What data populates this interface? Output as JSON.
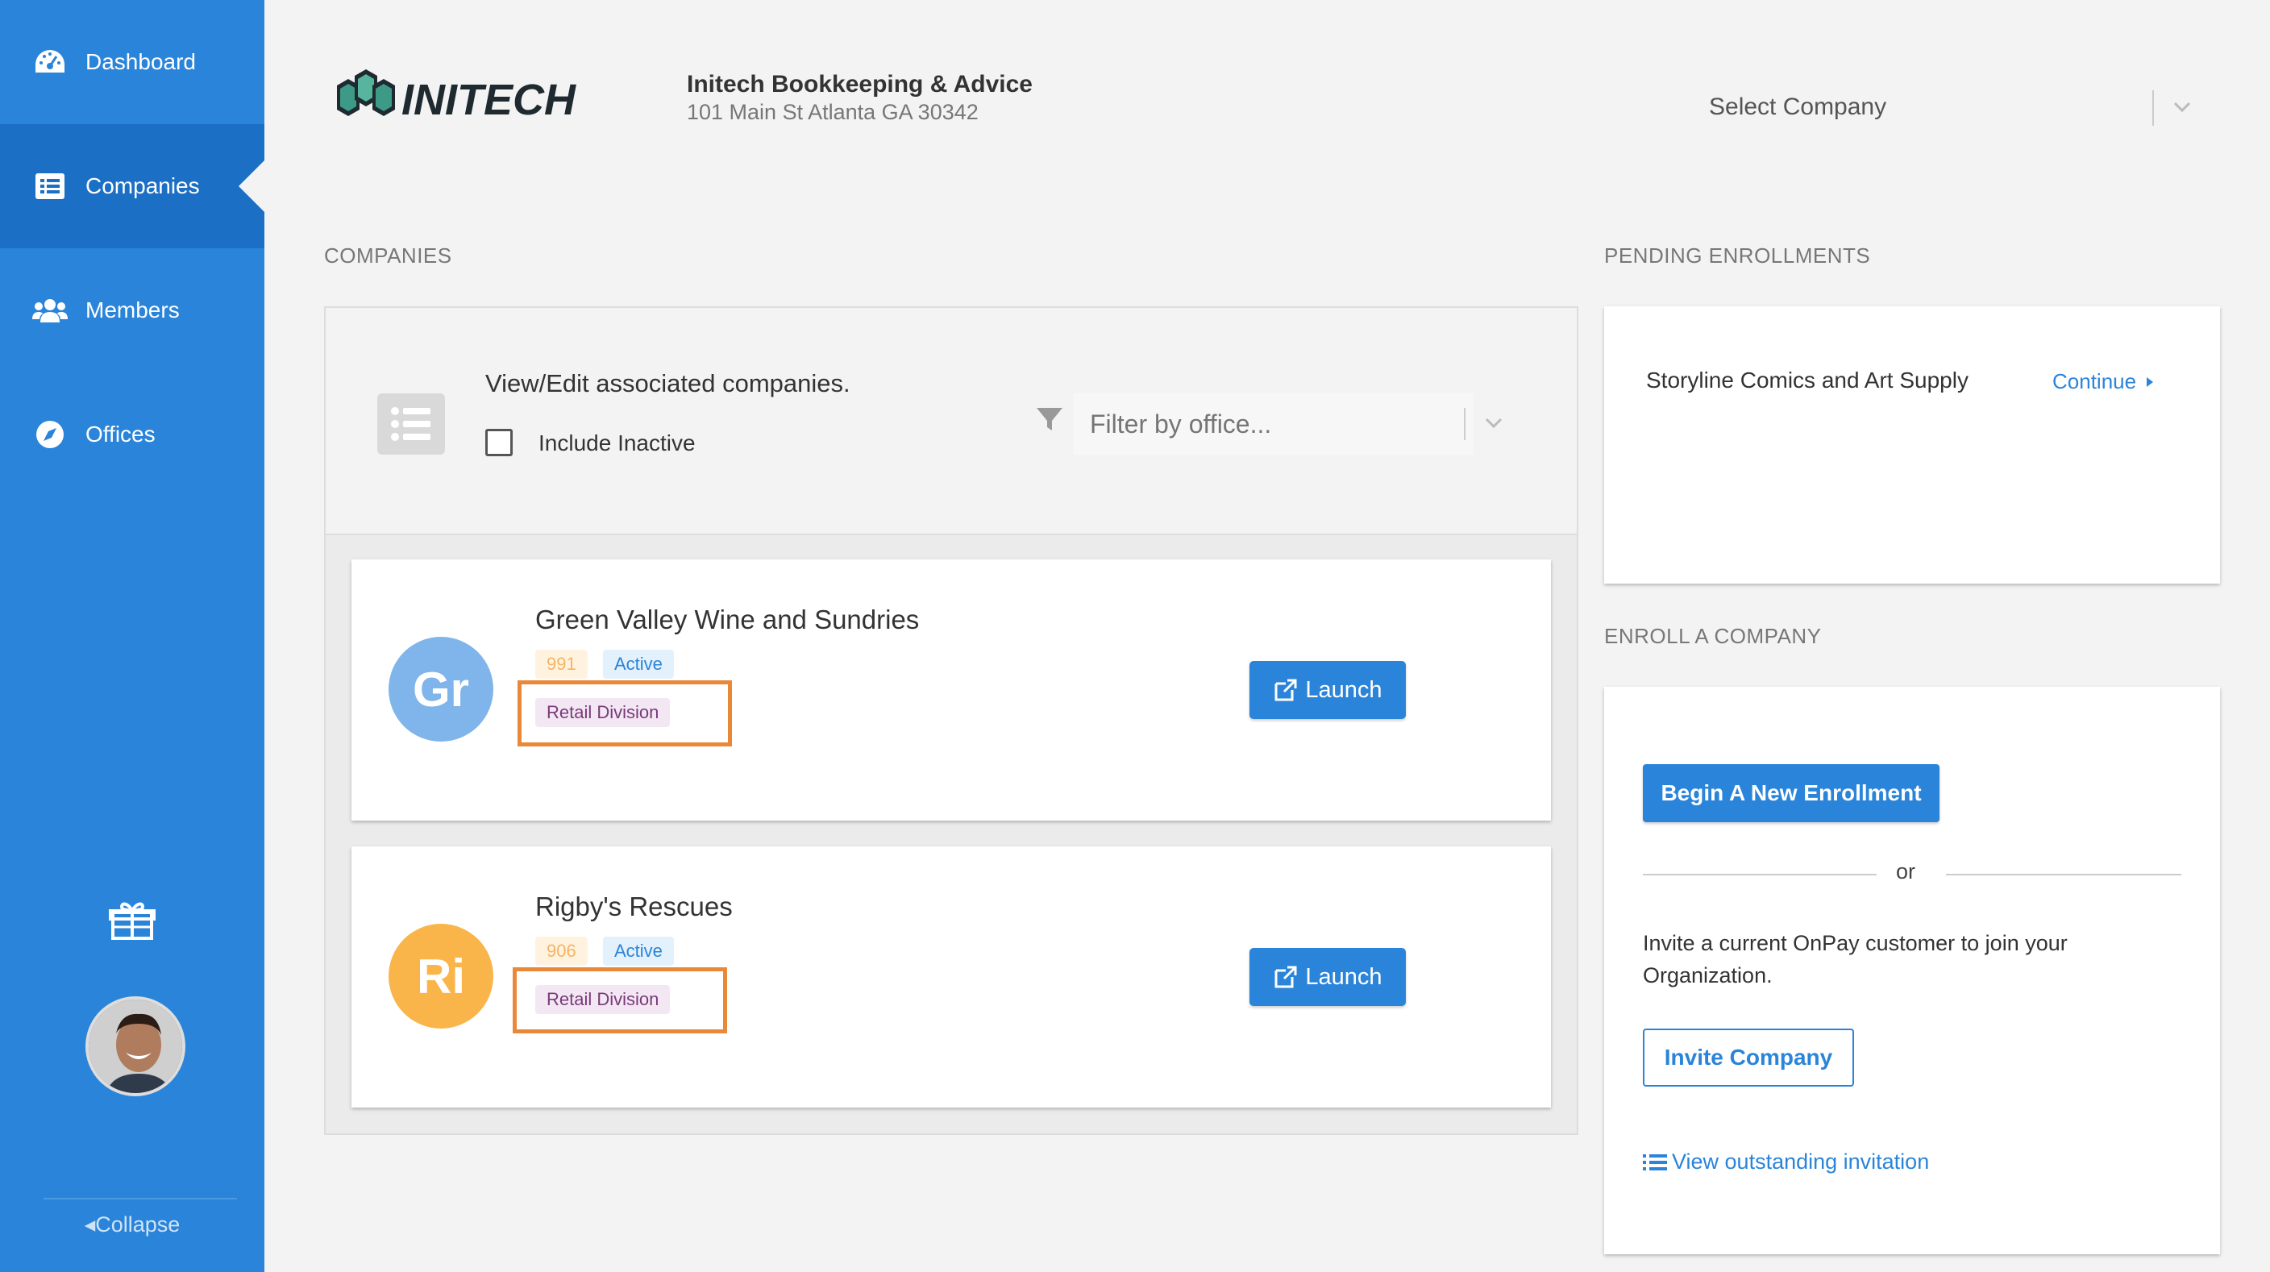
{
  "colors": {
    "primary": "#2a84d9",
    "sidebar_active": "#1b6fc4",
    "highlight": "#e98838"
  },
  "sidebar": {
    "items": [
      {
        "label": "Dashboard",
        "icon": "dashboard-icon"
      },
      {
        "label": "Companies",
        "icon": "list-icon",
        "active": true
      },
      {
        "label": "Members",
        "icon": "users-icon"
      },
      {
        "label": "Offices",
        "icon": "compass-icon"
      }
    ],
    "collapse_label": "Collapse"
  },
  "header": {
    "logo_text": "INITECH",
    "org_name": "Initech Bookkeeping & Advice",
    "org_address": "101 Main St Atlanta GA 30342",
    "select_company_placeholder": "Select Company"
  },
  "companies": {
    "section_label": "COMPANIES",
    "panel_title": "View/Edit associated companies.",
    "include_inactive_label": "Include Inactive",
    "filter_placeholder": "Filter by office...",
    "items": [
      {
        "initials": "Gr",
        "name": "Green Valley Wine and Sundries",
        "id": "991",
        "status": "Active",
        "division": "Retail Division",
        "avatar_color": "#7fb5ea",
        "launch_label": "Launch"
      },
      {
        "initials": "Ri",
        "name": "Rigby's Rescues",
        "id": "906",
        "status": "Active",
        "division": "Retail Division",
        "avatar_color": "#f9b54a",
        "launch_label": "Launch"
      }
    ]
  },
  "pending": {
    "section_label": "PENDING ENROLLMENTS",
    "company_name": "Storyline Comics and Art Supply",
    "continue_label": "Continue"
  },
  "enroll": {
    "section_label": "ENROLL A COMPANY",
    "begin_label": "Begin A New Enrollment",
    "or_label": "or",
    "invite_text": "Invite a current OnPay customer to join your Organization.",
    "invite_button_label": "Invite Company",
    "view_invitation_label": "View outstanding invitation"
  }
}
